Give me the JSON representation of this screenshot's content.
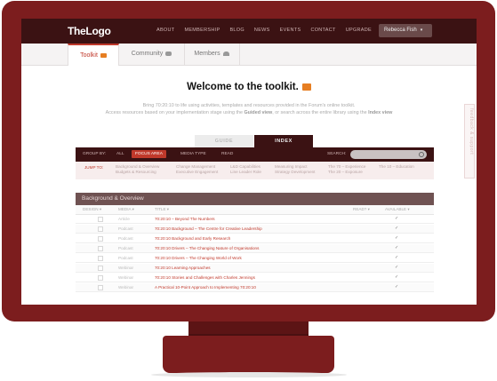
{
  "nav": {
    "logo": "TheLogo",
    "links": [
      "ABOUT",
      "MEMBERSHIP",
      "BLOG",
      "NEWS",
      "EVENTS",
      "CONTACT",
      "UPGRADE"
    ],
    "user": "Rebecca Fish"
  },
  "subtabs": [
    {
      "label": "Toolkit",
      "icon": "briefcase-icon"
    },
    {
      "label": "Community",
      "icon": "chat-icon"
    },
    {
      "label": "Members",
      "icon": "people-icon"
    }
  ],
  "welcome": "Welcome to the toolkit.",
  "intro": {
    "line1": "Bring 70:20:10 to life using activities, templates and resources provided in the Forum's online toolkit.",
    "line2_a": "Access resources based on your implementation stage using the ",
    "line2_guided": "Guided view",
    "line2_b": ", or search across the entire library using the ",
    "line2_index": "Index view"
  },
  "guide_tabs": {
    "guide": "GUIDE",
    "index": "INDEX"
  },
  "filter": {
    "group_by": "GROUP BY:",
    "options": [
      "ALL",
      "FOCUS AREA",
      "MEDIA TYPE",
      "READ"
    ],
    "active": "FOCUS AREA",
    "search_label": "SEARCH:",
    "search_value": ""
  },
  "jump": {
    "label": "JUMP TO:",
    "col1": [
      "Background & Overview",
      "Budgets & Resourcing"
    ],
    "col2": [
      "Change Management",
      "Executive Engagement"
    ],
    "col3": [
      "L&D Capabilities",
      "Line Leader Role"
    ],
    "col4": [
      "Measuring Impact",
      "Strategy Development"
    ],
    "col5": [
      "The 70 – Experience",
      "The 20 – Exposure"
    ],
    "col6": [
      "The 10 – Education"
    ]
  },
  "section": {
    "title": "Background & Overview"
  },
  "columns": {
    "design": "DESIGN ▾",
    "media": "MEDIA ▾",
    "title": "TITLE ▾",
    "read": "READ? ▾",
    "available": "AVAILABLE ▾"
  },
  "rows": [
    {
      "media": "Article",
      "title": "70:20:10 – Beyond The Numbers"
    },
    {
      "media": "Podcast",
      "title": "70:20:10 Background – The Centre for Creative Leadership"
    },
    {
      "media": "Podcast",
      "title": "70:20:10 Background and Early Research"
    },
    {
      "media": "Podcast",
      "title": "70:20:10 Drivers – The Changing Nature of Organisations"
    },
    {
      "media": "Podcast",
      "title": "70:20:10 Drivers – The Changing World of Work"
    },
    {
      "media": "Webinar",
      "title": "70:20:10 Learning Approaches"
    },
    {
      "media": "Webinar",
      "title": "70:20:10 Stories and Challenges with Charles Jennings"
    },
    {
      "media": "Webinar",
      "title": "A Practical 10-Point Approach to Implementing 70:20:10"
    }
  ],
  "feedback": "feedback & support",
  "colors": {
    "frame": "#7c1d1e",
    "nav": "#3b1213",
    "accent": "#c0392b"
  }
}
